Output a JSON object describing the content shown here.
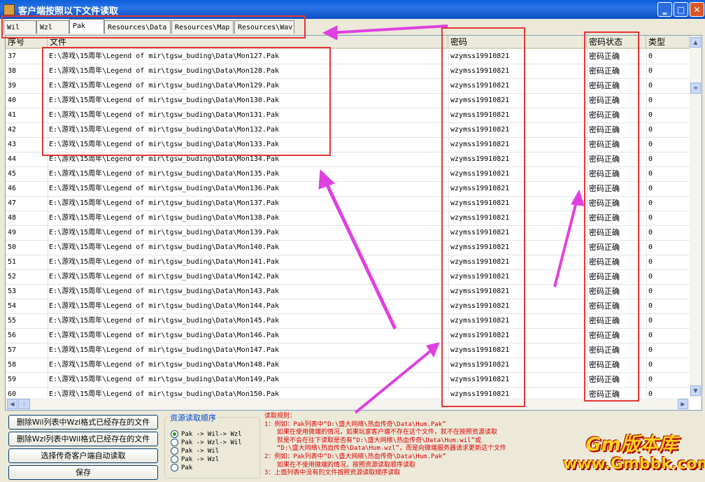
{
  "window": {
    "title": "客户端按照以下文件读取"
  },
  "tabs": [
    {
      "label": "Wil",
      "active": false
    },
    {
      "label": "Wzl",
      "active": false
    },
    {
      "label": "Pak",
      "active": true
    },
    {
      "label": "Resources\\Data",
      "active": false
    },
    {
      "label": "Resources\\Map",
      "active": false
    },
    {
      "label": "Resources\\Wav",
      "active": false
    }
  ],
  "grid": {
    "columns": [
      "序号",
      "文件",
      "密码",
      "密码状态",
      "类型"
    ],
    "rows": [
      {
        "no": "37",
        "file": "E:\\游戏\\15周年\\Legend of mir\\tgsw_buding\\Data\\Mon127.Pak",
        "pwd": "wzymss19910821",
        "status": "密码正确",
        "type": "0"
      },
      {
        "no": "38",
        "file": "E:\\游戏\\15周年\\Legend of mir\\tgsw_buding\\Data\\Mon128.Pak",
        "pwd": "wzymss19910821",
        "status": "密码正确",
        "type": "0"
      },
      {
        "no": "39",
        "file": "E:\\游戏\\15周年\\Legend of mir\\tgsw_buding\\Data\\Mon129.Pak",
        "pwd": "wzymss19910821",
        "status": "密码正确",
        "type": "0"
      },
      {
        "no": "40",
        "file": "E:\\游戏\\15周年\\Legend of mir\\tgsw_buding\\Data\\Mon130.Pak",
        "pwd": "wzymss19910821",
        "status": "密码正确",
        "type": "0"
      },
      {
        "no": "41",
        "file": "E:\\游戏\\15周年\\Legend of mir\\tgsw_buding\\Data\\Mon131.Pak",
        "pwd": "wzymss19910821",
        "status": "密码正确",
        "type": "0"
      },
      {
        "no": "42",
        "file": "E:\\游戏\\15周年\\Legend of mir\\tgsw_buding\\Data\\Mon132.Pak",
        "pwd": "wzymss19910821",
        "status": "密码正确",
        "type": "0"
      },
      {
        "no": "43",
        "file": "E:\\游戏\\15周年\\Legend of mir\\tgsw_buding\\Data\\Mon133.Pak",
        "pwd": "wzymss19910821",
        "status": "密码正确",
        "type": "0"
      },
      {
        "no": "44",
        "file": "E:\\游戏\\15周年\\Legend of mir\\tgsw_buding\\Data\\Mon134.Pak",
        "pwd": "wzymss19910821",
        "status": "密码正确",
        "type": "0"
      },
      {
        "no": "45",
        "file": "E:\\游戏\\15周年\\Legend of mir\\tgsw_buding\\Data\\Mon135.Pak",
        "pwd": "wzymss19910821",
        "status": "密码正确",
        "type": "0"
      },
      {
        "no": "46",
        "file": "E:\\游戏\\15周年\\Legend of mir\\tgsw_buding\\Data\\Mon136.Pak",
        "pwd": "wzymss19910821",
        "status": "密码正确",
        "type": "0"
      },
      {
        "no": "47",
        "file": "E:\\游戏\\15周年\\Legend of mir\\tgsw_buding\\Data\\Mon137.Pak",
        "pwd": "wzymss19910821",
        "status": "密码正确",
        "type": "0"
      },
      {
        "no": "48",
        "file": "E:\\游戏\\15周年\\Legend of mir\\tgsw_buding\\Data\\Mon138.Pak",
        "pwd": "wzymss19910821",
        "status": "密码正确",
        "type": "0"
      },
      {
        "no": "49",
        "file": "E:\\游戏\\15周年\\Legend of mir\\tgsw_buding\\Data\\Mon139.Pak",
        "pwd": "wzymss19910821",
        "status": "密码正确",
        "type": "0"
      },
      {
        "no": "50",
        "file": "E:\\游戏\\15周年\\Legend of mir\\tgsw_buding\\Data\\Mon140.Pak",
        "pwd": "wzymss19910821",
        "status": "密码正确",
        "type": "0"
      },
      {
        "no": "51",
        "file": "E:\\游戏\\15周年\\Legend of mir\\tgsw_buding\\Data\\Mon141.Pak",
        "pwd": "wzymss19910821",
        "status": "密码正确",
        "type": "0"
      },
      {
        "no": "52",
        "file": "E:\\游戏\\15周年\\Legend of mir\\tgsw_buding\\Data\\Mon142.Pak",
        "pwd": "wzymss19910821",
        "status": "密码正确",
        "type": "0"
      },
      {
        "no": "53",
        "file": "E:\\游戏\\15周年\\Legend of mir\\tgsw_buding\\Data\\Mon143.Pak",
        "pwd": "wzymss19910821",
        "status": "密码正确",
        "type": "0"
      },
      {
        "no": "54",
        "file": "E:\\游戏\\15周年\\Legend of mir\\tgsw_buding\\Data\\Mon144.Pak",
        "pwd": "wzymss19910821",
        "status": "密码正确",
        "type": "0"
      },
      {
        "no": "55",
        "file": "E:\\游戏\\15周年\\Legend of mir\\tgsw_buding\\Data\\Mon145.Pak",
        "pwd": "wzymss19910821",
        "status": "密码正确",
        "type": "0"
      },
      {
        "no": "56",
        "file": "E:\\游戏\\15周年\\Legend of mir\\tgsw_buding\\Data\\Mon146.Pak",
        "pwd": "wzymss19910821",
        "status": "密码正确",
        "type": "0"
      },
      {
        "no": "57",
        "file": "E:\\游戏\\15周年\\Legend of mir\\tgsw_buding\\Data\\Mon147.Pak",
        "pwd": "wzymss19910821",
        "status": "密码正确",
        "type": "0"
      },
      {
        "no": "58",
        "file": "E:\\游戏\\15周年\\Legend of mir\\tgsw_buding\\Data\\Mon148.Pak",
        "pwd": "wzymss19910821",
        "status": "密码正确",
        "type": "0"
      },
      {
        "no": "59",
        "file": "E:\\游戏\\15周年\\Legend of mir\\tgsw_buding\\Data\\Mon149.Pak",
        "pwd": "wzymss19910821",
        "status": "密码正确",
        "type": "0"
      },
      {
        "no": "60",
        "file": "E:\\游戏\\15周年\\Legend of mir\\tgsw_buding\\Data\\Mon150.Pak",
        "pwd": "wzymss19910821",
        "status": "密码正确",
        "type": "0"
      }
    ]
  },
  "buttons": {
    "delete_wil": "删除Wil列表中Wzl格式已经存在的文件",
    "delete_wzl": "删除Wzl列表中Wil格式已经存在的文件",
    "auto_read": "选择传奇客户端自动读取",
    "save": "保存"
  },
  "read_order": {
    "legend": "资源读取顺序",
    "options": [
      {
        "label": "Pak -> Wil-> Wzl",
        "checked": true
      },
      {
        "label": "Pak -> Wzl-> Wil",
        "checked": false
      },
      {
        "label": "Pak -> Wil",
        "checked": false
      },
      {
        "label": "Pak -> Wzl",
        "checked": false
      },
      {
        "label": "Pak",
        "checked": false
      }
    ]
  },
  "rules": {
    "heading": "读取规则：",
    "lines": [
      "1：例如：Pak列表中“D:\\盛大网络\\热血传奇\\Data\\Hum.Pak”",
      "如果在使用微端的情况，如果玩家客户端不存在这个文件，就不在按照资源读取",
      "就是不会在往下读取是否有“D:\\盛大网络\\热血传奇\\Data\\Hum.wil”或",
      "“D:\\盛大网络\\热血传奇\\Data\\Hum.wzl”，而是向微端服务器请求更新这个文件",
      "2：例如：Pak列表中“D:\\盛大网络\\热血传奇\\Data\\Hum.Pak”",
      "如果在不使用微端的情况，按照资源读取顺序读取",
      "3：上面列表中没有的文件按照资源读取顺序读取"
    ]
  },
  "watermark": {
    "line1": "Gm版本库",
    "line2": "www.Gmbbk.com"
  },
  "icons": {
    "app": "app-icon",
    "minimize": "minimize-icon",
    "maximize": "maximize-icon",
    "close": "close-icon"
  },
  "colors": {
    "annotation": "#e53535",
    "arrow": "#e040e0",
    "rules_text": "#e00000"
  }
}
